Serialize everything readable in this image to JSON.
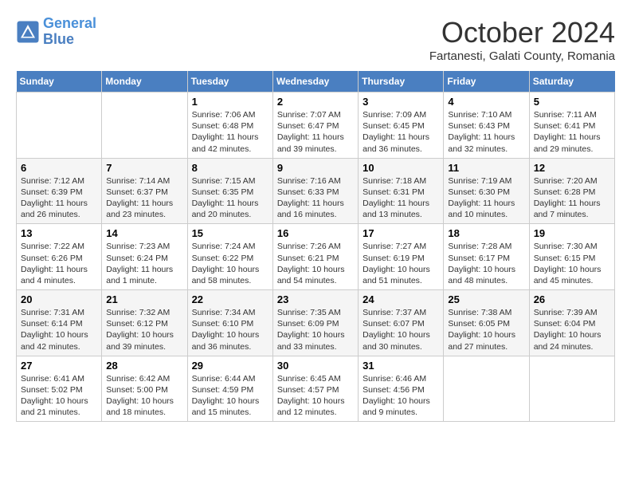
{
  "header": {
    "logo_line1": "General",
    "logo_line2": "Blue",
    "month": "October 2024",
    "location": "Fartanesti, Galati County, Romania"
  },
  "days_of_week": [
    "Sunday",
    "Monday",
    "Tuesday",
    "Wednesday",
    "Thursday",
    "Friday",
    "Saturday"
  ],
  "weeks": [
    [
      {
        "day": "",
        "sunrise": "",
        "sunset": "",
        "daylight": ""
      },
      {
        "day": "",
        "sunrise": "",
        "sunset": "",
        "daylight": ""
      },
      {
        "day": "1",
        "sunrise": "Sunrise: 7:06 AM",
        "sunset": "Sunset: 6:48 PM",
        "daylight": "Daylight: 11 hours and 42 minutes."
      },
      {
        "day": "2",
        "sunrise": "Sunrise: 7:07 AM",
        "sunset": "Sunset: 6:47 PM",
        "daylight": "Daylight: 11 hours and 39 minutes."
      },
      {
        "day": "3",
        "sunrise": "Sunrise: 7:09 AM",
        "sunset": "Sunset: 6:45 PM",
        "daylight": "Daylight: 11 hours and 36 minutes."
      },
      {
        "day": "4",
        "sunrise": "Sunrise: 7:10 AM",
        "sunset": "Sunset: 6:43 PM",
        "daylight": "Daylight: 11 hours and 32 minutes."
      },
      {
        "day": "5",
        "sunrise": "Sunrise: 7:11 AM",
        "sunset": "Sunset: 6:41 PM",
        "daylight": "Daylight: 11 hours and 29 minutes."
      }
    ],
    [
      {
        "day": "6",
        "sunrise": "Sunrise: 7:12 AM",
        "sunset": "Sunset: 6:39 PM",
        "daylight": "Daylight: 11 hours and 26 minutes."
      },
      {
        "day": "7",
        "sunrise": "Sunrise: 7:14 AM",
        "sunset": "Sunset: 6:37 PM",
        "daylight": "Daylight: 11 hours and 23 minutes."
      },
      {
        "day": "8",
        "sunrise": "Sunrise: 7:15 AM",
        "sunset": "Sunset: 6:35 PM",
        "daylight": "Daylight: 11 hours and 20 minutes."
      },
      {
        "day": "9",
        "sunrise": "Sunrise: 7:16 AM",
        "sunset": "Sunset: 6:33 PM",
        "daylight": "Daylight: 11 hours and 16 minutes."
      },
      {
        "day": "10",
        "sunrise": "Sunrise: 7:18 AM",
        "sunset": "Sunset: 6:31 PM",
        "daylight": "Daylight: 11 hours and 13 minutes."
      },
      {
        "day": "11",
        "sunrise": "Sunrise: 7:19 AM",
        "sunset": "Sunset: 6:30 PM",
        "daylight": "Daylight: 11 hours and 10 minutes."
      },
      {
        "day": "12",
        "sunrise": "Sunrise: 7:20 AM",
        "sunset": "Sunset: 6:28 PM",
        "daylight": "Daylight: 11 hours and 7 minutes."
      }
    ],
    [
      {
        "day": "13",
        "sunrise": "Sunrise: 7:22 AM",
        "sunset": "Sunset: 6:26 PM",
        "daylight": "Daylight: 11 hours and 4 minutes."
      },
      {
        "day": "14",
        "sunrise": "Sunrise: 7:23 AM",
        "sunset": "Sunset: 6:24 PM",
        "daylight": "Daylight: 11 hours and 1 minute."
      },
      {
        "day": "15",
        "sunrise": "Sunrise: 7:24 AM",
        "sunset": "Sunset: 6:22 PM",
        "daylight": "Daylight: 10 hours and 58 minutes."
      },
      {
        "day": "16",
        "sunrise": "Sunrise: 7:26 AM",
        "sunset": "Sunset: 6:21 PM",
        "daylight": "Daylight: 10 hours and 54 minutes."
      },
      {
        "day": "17",
        "sunrise": "Sunrise: 7:27 AM",
        "sunset": "Sunset: 6:19 PM",
        "daylight": "Daylight: 10 hours and 51 minutes."
      },
      {
        "day": "18",
        "sunrise": "Sunrise: 7:28 AM",
        "sunset": "Sunset: 6:17 PM",
        "daylight": "Daylight: 10 hours and 48 minutes."
      },
      {
        "day": "19",
        "sunrise": "Sunrise: 7:30 AM",
        "sunset": "Sunset: 6:15 PM",
        "daylight": "Daylight: 10 hours and 45 minutes."
      }
    ],
    [
      {
        "day": "20",
        "sunrise": "Sunrise: 7:31 AM",
        "sunset": "Sunset: 6:14 PM",
        "daylight": "Daylight: 10 hours and 42 minutes."
      },
      {
        "day": "21",
        "sunrise": "Sunrise: 7:32 AM",
        "sunset": "Sunset: 6:12 PM",
        "daylight": "Daylight: 10 hours and 39 minutes."
      },
      {
        "day": "22",
        "sunrise": "Sunrise: 7:34 AM",
        "sunset": "Sunset: 6:10 PM",
        "daylight": "Daylight: 10 hours and 36 minutes."
      },
      {
        "day": "23",
        "sunrise": "Sunrise: 7:35 AM",
        "sunset": "Sunset: 6:09 PM",
        "daylight": "Daylight: 10 hours and 33 minutes."
      },
      {
        "day": "24",
        "sunrise": "Sunrise: 7:37 AM",
        "sunset": "Sunset: 6:07 PM",
        "daylight": "Daylight: 10 hours and 30 minutes."
      },
      {
        "day": "25",
        "sunrise": "Sunrise: 7:38 AM",
        "sunset": "Sunset: 6:05 PM",
        "daylight": "Daylight: 10 hours and 27 minutes."
      },
      {
        "day": "26",
        "sunrise": "Sunrise: 7:39 AM",
        "sunset": "Sunset: 6:04 PM",
        "daylight": "Daylight: 10 hours and 24 minutes."
      }
    ],
    [
      {
        "day": "27",
        "sunrise": "Sunrise: 6:41 AM",
        "sunset": "Sunset: 5:02 PM",
        "daylight": "Daylight: 10 hours and 21 minutes."
      },
      {
        "day": "28",
        "sunrise": "Sunrise: 6:42 AM",
        "sunset": "Sunset: 5:00 PM",
        "daylight": "Daylight: 10 hours and 18 minutes."
      },
      {
        "day": "29",
        "sunrise": "Sunrise: 6:44 AM",
        "sunset": "Sunset: 4:59 PM",
        "daylight": "Daylight: 10 hours and 15 minutes."
      },
      {
        "day": "30",
        "sunrise": "Sunrise: 6:45 AM",
        "sunset": "Sunset: 4:57 PM",
        "daylight": "Daylight: 10 hours and 12 minutes."
      },
      {
        "day": "31",
        "sunrise": "Sunrise: 6:46 AM",
        "sunset": "Sunset: 4:56 PM",
        "daylight": "Daylight: 10 hours and 9 minutes."
      },
      {
        "day": "",
        "sunrise": "",
        "sunset": "",
        "daylight": ""
      },
      {
        "day": "",
        "sunrise": "",
        "sunset": "",
        "daylight": ""
      }
    ]
  ]
}
